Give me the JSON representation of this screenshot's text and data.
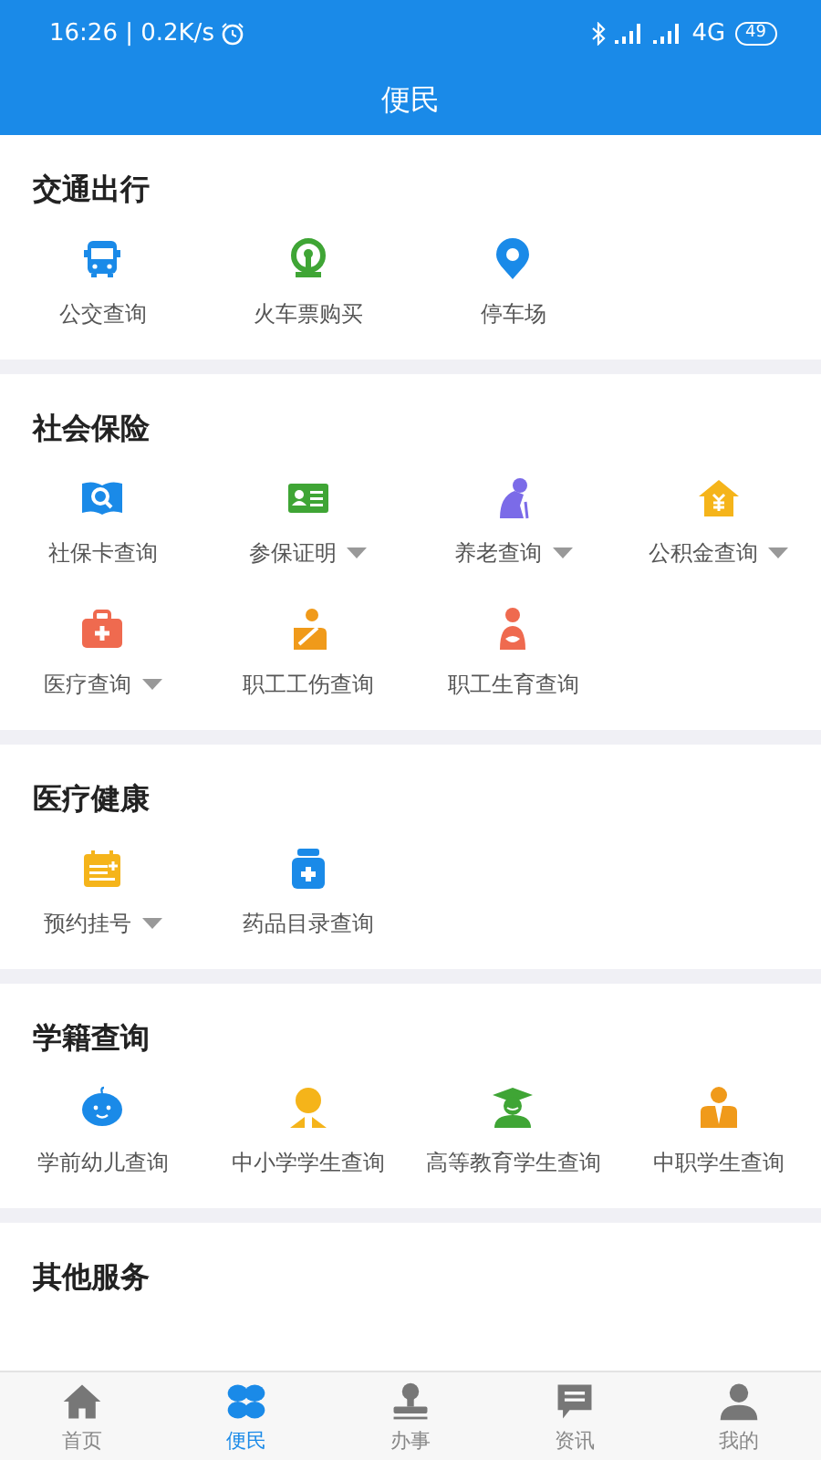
{
  "status_bar": {
    "left_text": "16:26 | 0.2K/s",
    "network": "4G",
    "battery": "49"
  },
  "header": {
    "title": "便民"
  },
  "sections": [
    {
      "title": "交通出行",
      "items": [
        {
          "label": "公交查询",
          "has_dropdown": false
        },
        {
          "label": "火车票购买",
          "has_dropdown": false
        },
        {
          "label": "停车场",
          "has_dropdown": false
        }
      ]
    },
    {
      "title": "社会保险",
      "items": [
        {
          "label": "社保卡查询",
          "has_dropdown": false
        },
        {
          "label": "参保证明",
          "has_dropdown": true
        },
        {
          "label": "养老查询",
          "has_dropdown": true
        },
        {
          "label": "公积金查询",
          "has_dropdown": true
        },
        {
          "label": "医疗查询",
          "has_dropdown": true
        },
        {
          "label": "职工工伤查询",
          "has_dropdown": false
        },
        {
          "label": "职工生育查询",
          "has_dropdown": false
        }
      ]
    },
    {
      "title": "医疗健康",
      "items": [
        {
          "label": "预约挂号",
          "has_dropdown": true
        },
        {
          "label": "药品目录查询",
          "has_dropdown": false
        }
      ]
    },
    {
      "title": "学籍查询",
      "items": [
        {
          "label": "学前幼儿查询",
          "has_dropdown": false
        },
        {
          "label": "中小学学生查询",
          "has_dropdown": false
        },
        {
          "label": "高等教育学生查询",
          "has_dropdown": false
        },
        {
          "label": "中职学生查询",
          "has_dropdown": false
        }
      ]
    },
    {
      "title": "其他服务"
    }
  ],
  "tab_bar": [
    {
      "label": "首页",
      "selected": false
    },
    {
      "label": "便民",
      "selected": true
    },
    {
      "label": "办事",
      "selected": false
    },
    {
      "label": "资讯",
      "selected": false
    },
    {
      "label": "我的",
      "selected": false
    }
  ]
}
